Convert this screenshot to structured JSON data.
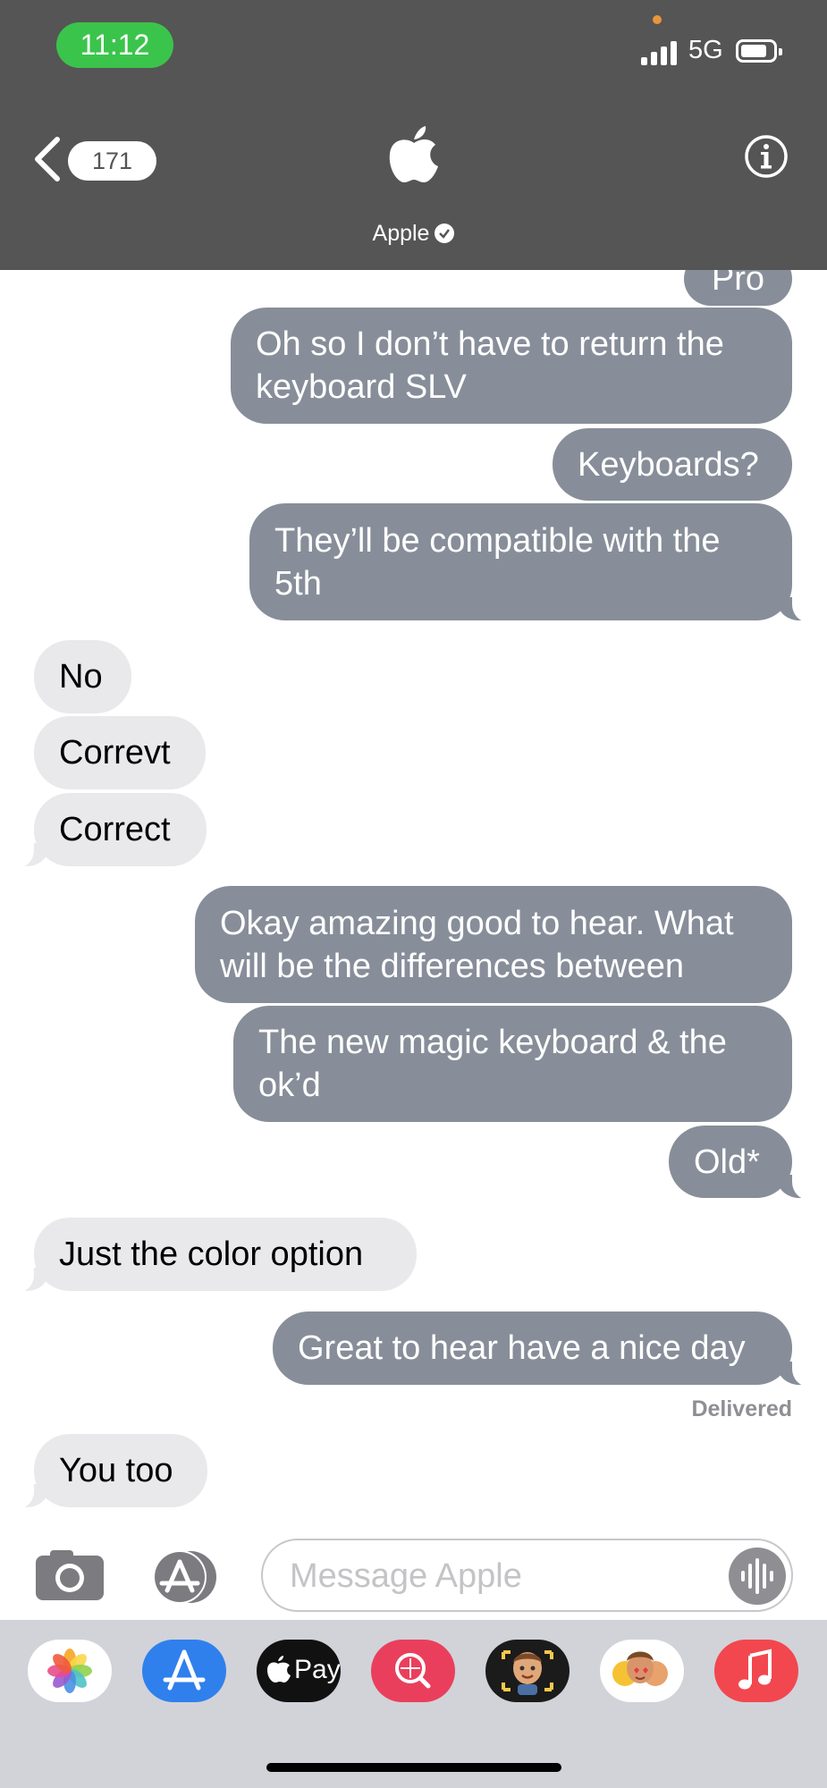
{
  "status_bar": {
    "time": "11:12",
    "network": "5G"
  },
  "header": {
    "back_count": "171",
    "contact_name": "Apple"
  },
  "messages": [
    {
      "text": "Pro",
      "dir": "out"
    },
    {
      "text": "Oh so I don’t have to return the keyboard SLV",
      "dir": "out"
    },
    {
      "text": "Keyboards?",
      "dir": "out"
    },
    {
      "text": "They’ll be compatible with the 5th",
      "dir": "out"
    },
    {
      "text": "No",
      "dir": "in"
    },
    {
      "text": "Correvt",
      "dir": "in"
    },
    {
      "text": "Correct",
      "dir": "in"
    },
    {
      "text": "Okay amazing good to hear. What will be the differences between",
      "dir": "out"
    },
    {
      "text": "The new magic keyboard & the ok’d",
      "dir": "out"
    },
    {
      "text": "Old*",
      "dir": "out"
    },
    {
      "text": "Just the color option",
      "dir": "in"
    },
    {
      "text": "Great to hear have a nice day",
      "dir": "out"
    },
    {
      "text": "You too",
      "dir": "in"
    }
  ],
  "delivered_label": "Delivered",
  "input": {
    "placeholder": "Message Apple"
  },
  "apps": [
    "photos-icon",
    "app-store-icon",
    "apple-pay-icon",
    "image-search-icon",
    "memoji-icon",
    "memoji-stickers-icon",
    "music-icon"
  ],
  "apple_pay_label": "Pay",
  "colors": {
    "header_bg": "#555555",
    "outgoing_bubble": "#878e99",
    "incoming_bubble": "#e9e9eb",
    "time_pill": "#3bc44b"
  }
}
